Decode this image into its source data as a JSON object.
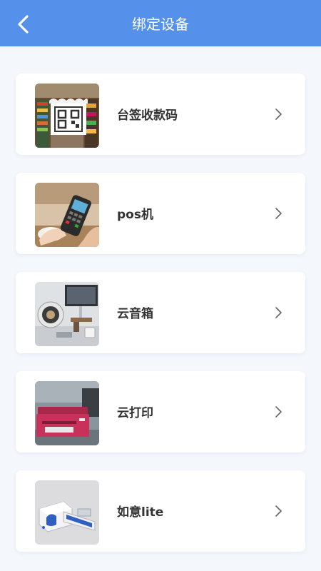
{
  "header": {
    "title": "绑定设备",
    "background": "#5591ea"
  },
  "devices": [
    {
      "label": "台签收款码",
      "icon": "qr-stand-photo"
    },
    {
      "label": "pos机",
      "icon": "pos-terminal-photo"
    },
    {
      "label": "云音箱",
      "icon": "cloud-speaker-photo"
    },
    {
      "label": "云打印",
      "icon": "cloud-printer-photo"
    },
    {
      "label": "如意lite",
      "icon": "ruyi-lite-photo"
    }
  ]
}
